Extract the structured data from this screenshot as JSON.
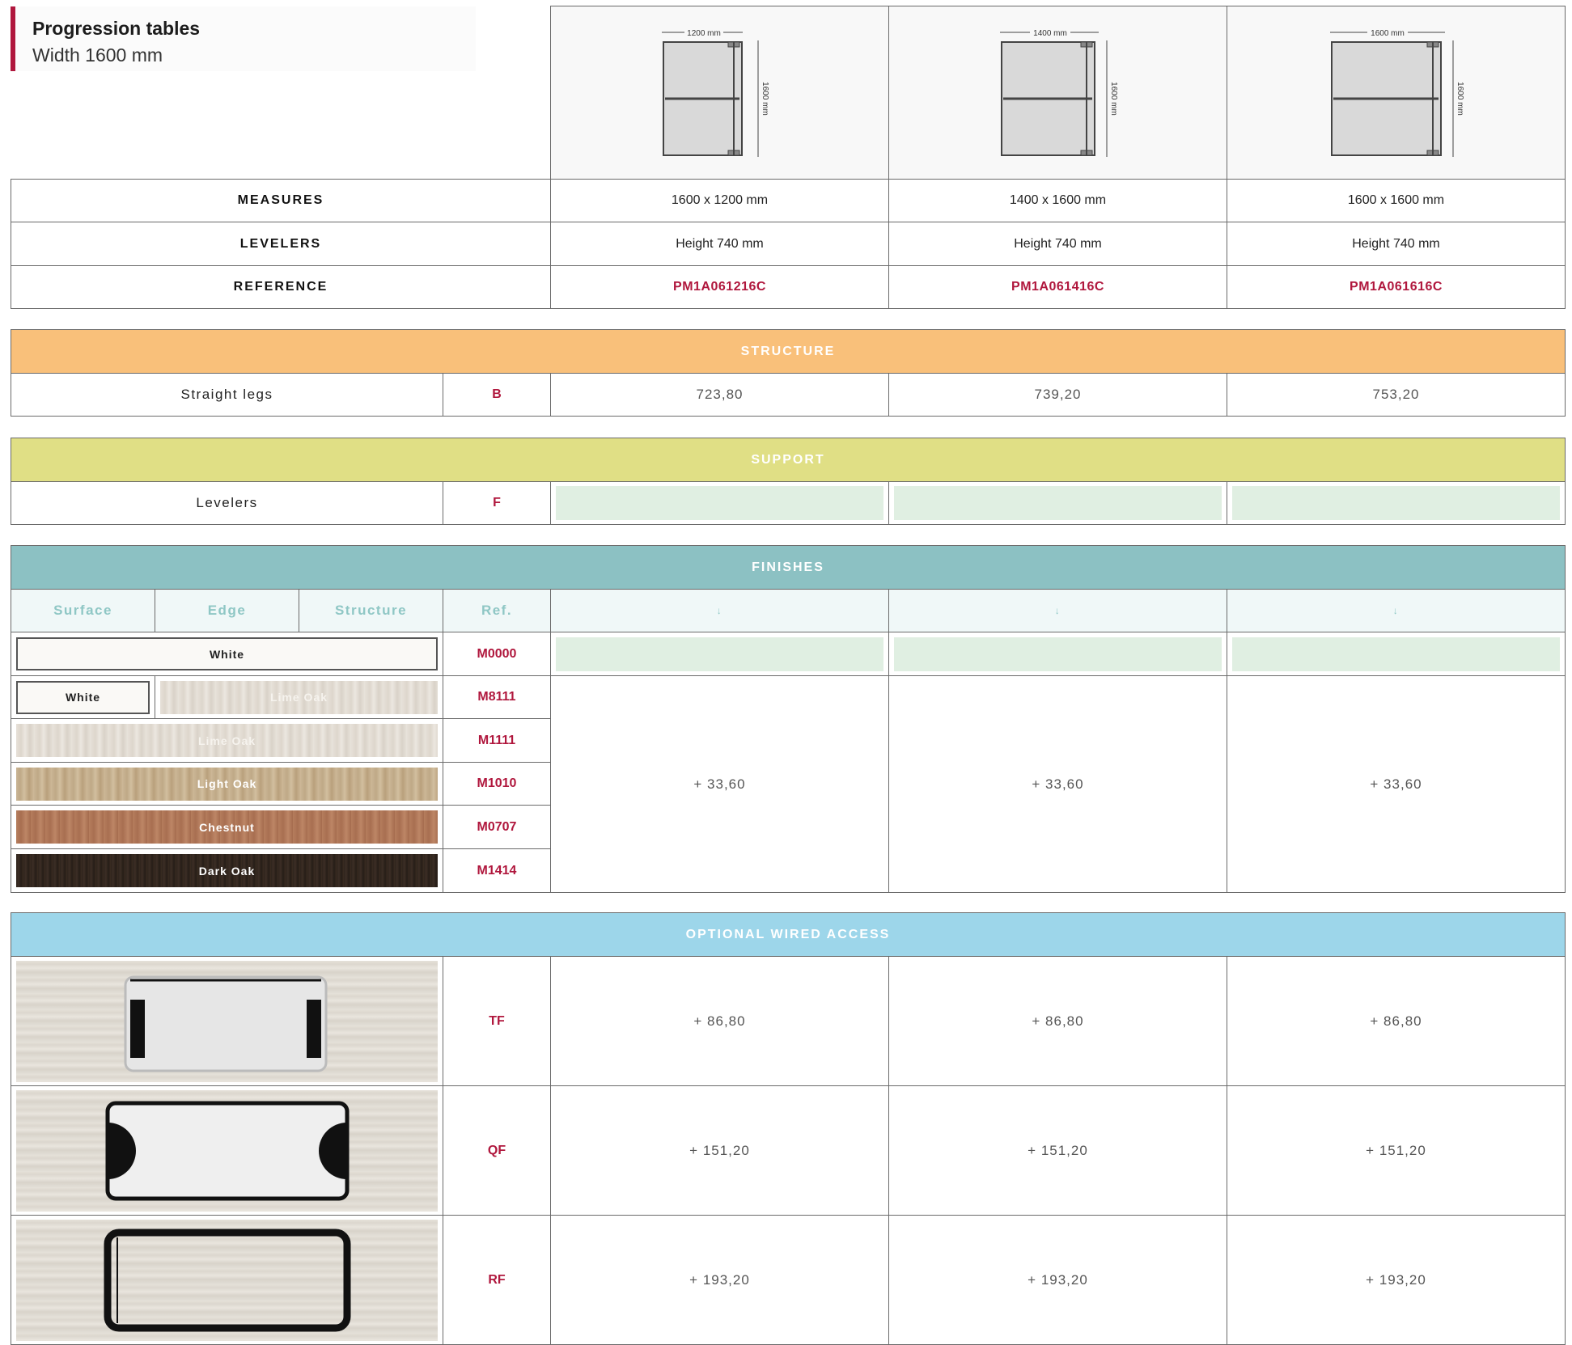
{
  "header": {
    "title": "Progression tables",
    "subtitle": "Width 1600 mm"
  },
  "diagrams": [
    {
      "width_label": "1200 mm",
      "depth_label": "1600 mm"
    },
    {
      "width_label": "1400 mm",
      "depth_label": "1600 mm"
    },
    {
      "width_label": "1600 mm",
      "depth_label": "1600 mm"
    }
  ],
  "specs": {
    "measures_label": "MEASURES",
    "levelers_label": "LEVELERS",
    "reference_label": "REFERENCE",
    "measures": [
      "1600 x 1200 mm",
      "1400 x 1600 mm",
      "1600 x 1600 mm"
    ],
    "levelers": [
      "Height 740 mm",
      "Height 740 mm",
      "Height 740 mm"
    ],
    "references": [
      "PM1A061216C",
      "PM1A061416C",
      "PM1A061616C"
    ]
  },
  "structure": {
    "title": "STRUCTURE",
    "color": "#f9c07a",
    "row_label": "Straight legs",
    "code": "B",
    "prices": [
      "723,80",
      "739,20",
      "753,20"
    ]
  },
  "support": {
    "title": "SUPPORT",
    "color": "#e0df85",
    "row_label": "Levelers",
    "code": "F"
  },
  "finishes": {
    "title": "FINISHES",
    "color": "#8cc1c3",
    "headers": {
      "surface": "Surface",
      "edge": "Edge",
      "structure": "Structure",
      "ref": "Ref.",
      "arrow": "↓"
    },
    "rows": [
      {
        "surface": "White",
        "code": "M0000"
      },
      {
        "edge": "White",
        "surface": "Lime Oak",
        "code": "M8111"
      },
      {
        "surface": "Lime Oak",
        "code": "M1111"
      },
      {
        "surface": "Light Oak",
        "code": "M1010"
      },
      {
        "surface": "Chestnut",
        "code": "M0707"
      },
      {
        "surface": "Dark Oak",
        "code": "M1414"
      }
    ],
    "surcharge": [
      "+ 33,60",
      "+ 33,60",
      "+ 33,60"
    ]
  },
  "wired": {
    "title": "OPTIONAL WIRED ACCESS",
    "color": "#9dd6ea",
    "rows": [
      {
        "code": "TF",
        "prices": [
          "+ 86,80",
          "+ 86,80",
          "+ 86,80"
        ]
      },
      {
        "code": "QF",
        "prices": [
          "+ 151,20",
          "+ 151,20",
          "+ 151,20"
        ]
      },
      {
        "code": "RF",
        "prices": [
          "+ 193,20",
          "+ 193,20",
          "+ 193,20"
        ]
      }
    ]
  }
}
